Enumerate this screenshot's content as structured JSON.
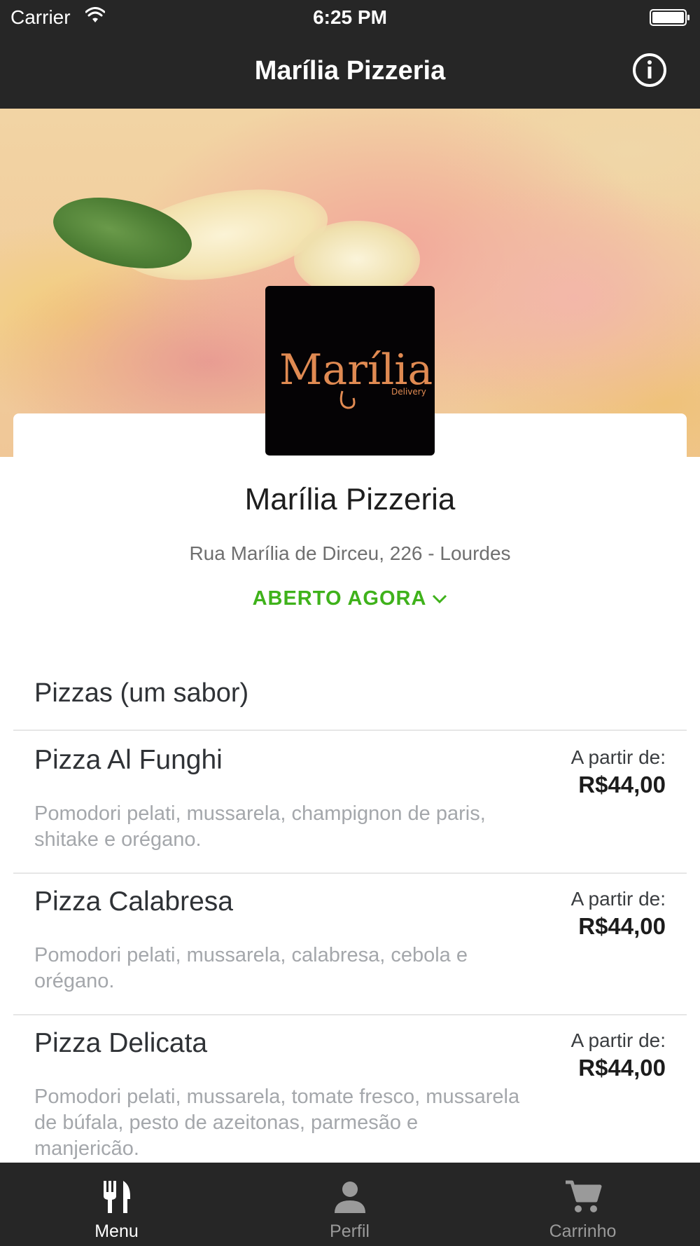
{
  "status_bar": {
    "carrier": "Carrier",
    "time": "6:25 PM"
  },
  "nav": {
    "title": "Marília Pizzeria"
  },
  "logo": {
    "text": "Marília",
    "subtext": "Delivery"
  },
  "restaurant": {
    "name": "Marília Pizzeria",
    "address": "Rua Marília de Dirceu, 226 - Lourdes",
    "status": "ABERTO AGORA",
    "status_color": "#3fb21b"
  },
  "menu": {
    "section_title": "Pizzas (um sabor)",
    "items": [
      {
        "name": "Pizza Al Funghi",
        "description": "Pomodori pelati, mussarela, champignon de paris, shitake e orégano.",
        "price_label": "A partir de:",
        "price": "R$44,00"
      },
      {
        "name": "Pizza Calabresa",
        "description": "Pomodori pelati, mussarela, calabresa, cebola e orégano.",
        "price_label": "A partir de:",
        "price": "R$44,00"
      },
      {
        "name": "Pizza Delicata",
        "description": "Pomodori pelati, mussarela, tomate fresco, mussarela de búfala, pesto de azeitonas, parmesão e manjericão.",
        "price_label": "A partir de:",
        "price": "R$44,00"
      }
    ]
  },
  "tabs": [
    {
      "label": "Menu",
      "icon": "fork-knife-icon",
      "active": true
    },
    {
      "label": "Perfil",
      "icon": "person-icon",
      "active": false
    },
    {
      "label": "Carrinho",
      "icon": "cart-icon",
      "active": false
    }
  ],
  "colors": {
    "bar": "#262626",
    "active_tab": "#ffffff",
    "inactive_tab": "#9a9a9a"
  }
}
